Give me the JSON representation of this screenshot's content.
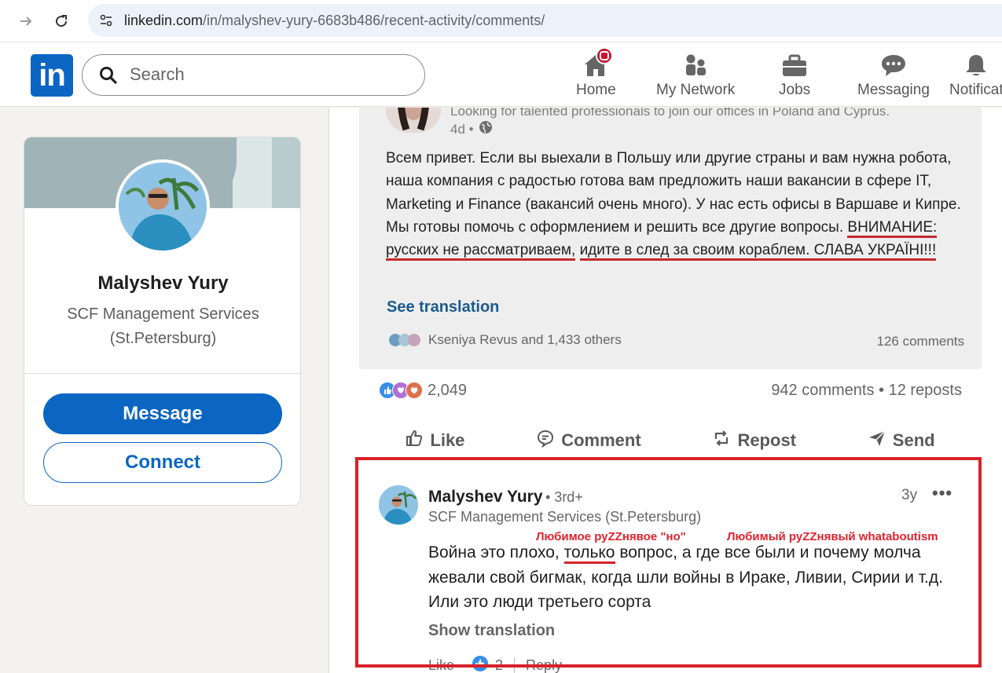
{
  "browser": {
    "url_host": "linkedin.com",
    "url_path": "/in/malyshev-yury-6683b486/recent-activity/comments/"
  },
  "header": {
    "logo_text": "in",
    "search_placeholder": "Search",
    "nav": [
      {
        "label": "Home",
        "icon": "home-icon"
      },
      {
        "label": "My Network",
        "icon": "network-icon"
      },
      {
        "label": "Jobs",
        "icon": "briefcase-icon"
      },
      {
        "label": "Messaging",
        "icon": "messaging-icon"
      },
      {
        "label": "Notificat",
        "icon": "bell-icon"
      }
    ]
  },
  "profile_card": {
    "name": "Malyshev Yury",
    "org": "SCF Management Services (St.Petersburg)",
    "message_label": "Message",
    "connect_label": "Connect"
  },
  "embedded_post": {
    "headline": "Looking for talented professionals to join our offices in Poland and Cyprus.",
    "time": "4d •",
    "body_plain": "Всем привет. Если вы выехали в Польшу или другие страны и вам нужна робота, наша компания с радостью готова вам предложить наши вакансии в сфере IT, Marketing и Finance (вакансий очень много). У нас есть офисы в Варшаве и Кипре. Мы готовы помочь с оформлением и решить все другие вопросы. ",
    "body_underlined_1": "ВНИМАНИЕ: русских не рассматриваем,",
    "body_underlined_2": "идите в след за своим кораблем. СЛАВА УКРАЇНІ!!!",
    "see_translation": "See translation",
    "reactions_text": "Kseniya Revus and 1,433 others",
    "comments_text": "126 comments"
  },
  "post_stats": {
    "reactions_count": "2,049",
    "comments_reposts": "942 comments • 12 reposts"
  },
  "actions": {
    "like": "Like",
    "comment": "Comment",
    "repost": "Repost",
    "send": "Send"
  },
  "comment": {
    "author": "Malyshev Yury",
    "degree": "• 3rd+",
    "org": "SCF Management Services (St.Petersburg)",
    "time": "3y",
    "more": "•••",
    "annotation_1": "Любимое руZZнявое \"но\"",
    "annotation_2": "Любимый руZZнявый whataboutism",
    "body_before": "Война это плохо, ",
    "body_underlined": "только",
    "body_after": " вопрос, а где все были и почему молча жевали свой бигмак, когда шли войны в Ираке, Ливии, Сирии и т.д. Или это люди третьего сорта",
    "show_translation": "Show translation",
    "like_label": "Like",
    "like_sep": "·",
    "reaction_count": "2",
    "reply_label": "Reply"
  },
  "colors": {
    "linkedin_blue": "#0a66c2",
    "highlight_red": "#d7212a",
    "notification_red": "#cb112d"
  }
}
